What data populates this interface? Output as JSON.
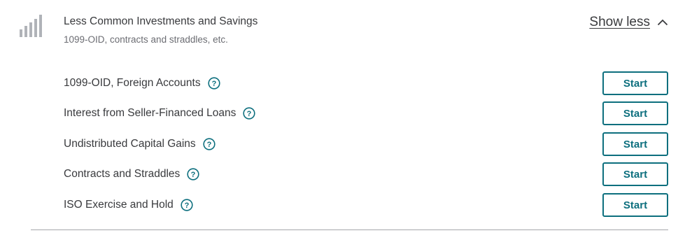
{
  "section": {
    "icon": "bar-chart-icon",
    "title": "Less Common Investments and Savings",
    "subtitle": "1099-OID, contracts and straddles, etc.",
    "toggle_label": "Show less",
    "toggle_icon": "chevron-up-icon"
  },
  "rows": [
    {
      "label": "1099-OID, Foreign Accounts",
      "button": "Start"
    },
    {
      "label": "Interest from Seller-Financed Loans",
      "button": "Start"
    },
    {
      "label": "Undistributed Capital Gains",
      "button": "Start"
    },
    {
      "label": "Contracts and Straddles",
      "button": "Start"
    },
    {
      "label": "ISO Exercise and Hold",
      "button": "Start"
    }
  ],
  "colors": {
    "accent": "#0d6f7e",
    "text": "#393a3d",
    "muted": "#6b6c72",
    "icon_gray": "#b0b3b8",
    "divider": "#a5a7ab"
  }
}
